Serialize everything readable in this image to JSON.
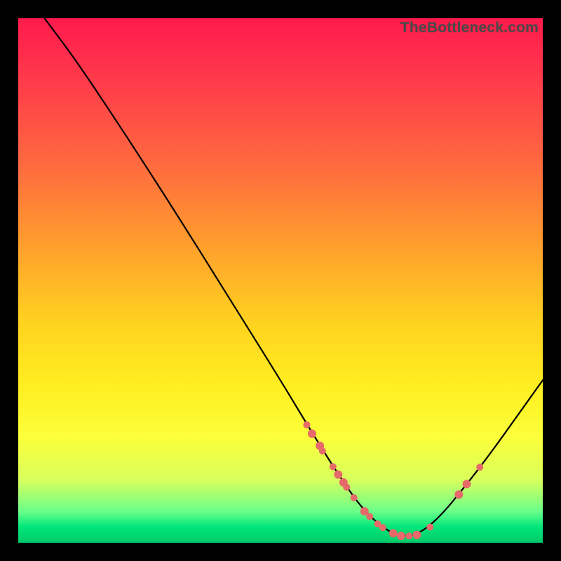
{
  "watermark": "TheBottleneck.com",
  "chart_data": {
    "type": "line",
    "title": "",
    "xlabel": "",
    "ylabel": "",
    "xlim": [
      0,
      100
    ],
    "ylim": [
      0,
      100
    ],
    "curve": [
      {
        "x": 5.0,
        "y": 100.0
      },
      {
        "x": 11.0,
        "y": 92.0
      },
      {
        "x": 20.0,
        "y": 78.5
      },
      {
        "x": 30.0,
        "y": 63.0
      },
      {
        "x": 40.0,
        "y": 47.0
      },
      {
        "x": 50.0,
        "y": 31.0
      },
      {
        "x": 56.0,
        "y": 21.0
      },
      {
        "x": 62.0,
        "y": 11.5
      },
      {
        "x": 66.0,
        "y": 6.0
      },
      {
        "x": 70.0,
        "y": 2.5
      },
      {
        "x": 73.0,
        "y": 1.2
      },
      {
        "x": 76.0,
        "y": 1.5
      },
      {
        "x": 80.0,
        "y": 4.5
      },
      {
        "x": 85.0,
        "y": 10.5
      },
      {
        "x": 90.0,
        "y": 17.0
      },
      {
        "x": 95.0,
        "y": 24.0
      },
      {
        "x": 100.0,
        "y": 31.0
      }
    ],
    "markers": [
      {
        "x": 55.0,
        "y": 22.5,
        "r": 5
      },
      {
        "x": 56.0,
        "y": 20.8,
        "r": 6
      },
      {
        "x": 57.5,
        "y": 18.5,
        "r": 6
      },
      {
        "x": 58.0,
        "y": 17.5,
        "r": 5
      },
      {
        "x": 60.0,
        "y": 14.5,
        "r": 5
      },
      {
        "x": 61.0,
        "y": 13.0,
        "r": 6
      },
      {
        "x": 62.0,
        "y": 11.5,
        "r": 6
      },
      {
        "x": 62.6,
        "y": 10.6,
        "r": 5
      },
      {
        "x": 64.0,
        "y": 8.6,
        "r": 5
      },
      {
        "x": 66.0,
        "y": 6.0,
        "r": 6
      },
      {
        "x": 67.0,
        "y": 5.0,
        "r": 5
      },
      {
        "x": 68.5,
        "y": 3.6,
        "r": 5
      },
      {
        "x": 69.5,
        "y": 2.9,
        "r": 5
      },
      {
        "x": 71.5,
        "y": 1.8,
        "r": 6
      },
      {
        "x": 73.0,
        "y": 1.3,
        "r": 6
      },
      {
        "x": 74.5,
        "y": 1.3,
        "r": 5
      },
      {
        "x": 76.0,
        "y": 1.5,
        "r": 6
      },
      {
        "x": 78.5,
        "y": 3.0,
        "r": 5
      },
      {
        "x": 84.0,
        "y": 9.2,
        "r": 6
      },
      {
        "x": 85.5,
        "y": 11.2,
        "r": 6
      },
      {
        "x": 88.0,
        "y": 14.4,
        "r": 5
      }
    ],
    "colors": {
      "curve": "#000000",
      "marker": "#e66a6a",
      "gradient_top": "#ff1a4d",
      "gradient_bottom": "#00c869"
    }
  }
}
